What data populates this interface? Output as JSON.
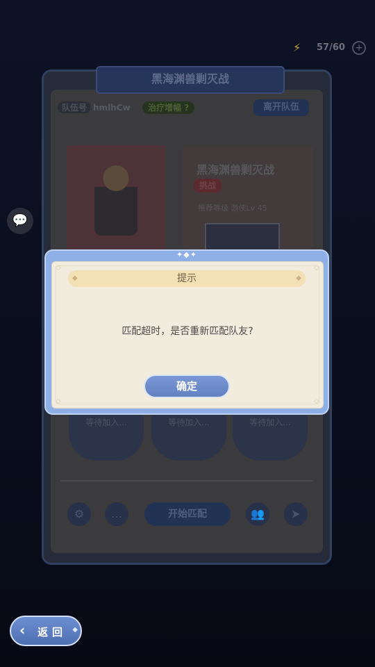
{
  "energy": {
    "icon": "lightning-icon",
    "count": "57/60",
    "plus": "+"
  },
  "panel": {
    "title": "黑海渊兽剿灭战",
    "team_id_label": "队伍号",
    "team_id": "hmlhCw",
    "heal_tag": "治疗增幅",
    "heal_help": "?",
    "leave_button": "离开队伍",
    "boss_name": "黑海渊兽剿灭战",
    "boss_badge": "挑战",
    "level_text": "推荐等级 游侠Lv 45",
    "slots": [
      "等待加入...",
      "等待加入...",
      "等待加入..."
    ],
    "match_button": "开始匹配"
  },
  "dialog": {
    "title": "提示",
    "message": "匹配超时，是否重新匹配队友?",
    "confirm_button": "确定"
  },
  "back_button": "返回"
}
